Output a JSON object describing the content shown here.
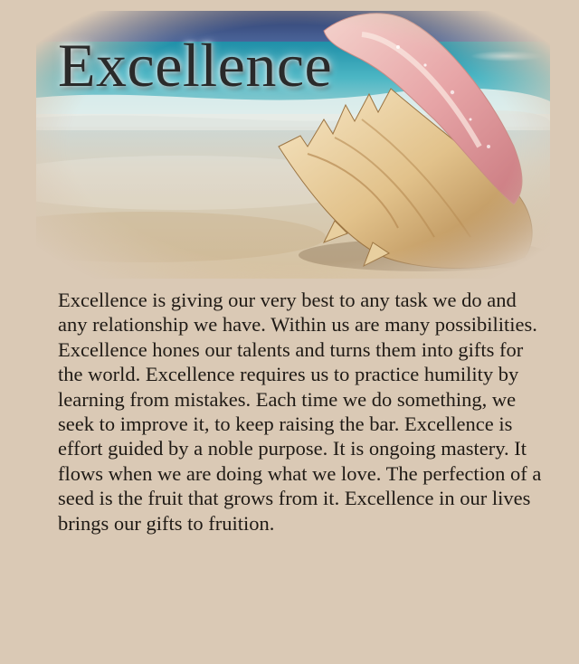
{
  "title": "Excellence",
  "body": "Excellence is giving our very best to any task we do and any relationship we have. Within us are many possibilities. Excellence hones our talents and turns them into gifts for the world. Excellence requires us to practice humility by learning from mistakes. Each time we do something, we seek to improve it, to keep raising the bar. Excellence is effort guided by a noble purpose. It is ongoing mastery. It flows when we are doing what we love. The perfection of a seed is the fruit that grows from it. Excellence in our lives brings our gifts to fruition.",
  "colors": {
    "background": "#dac9b5",
    "sea": "#3aa8b8",
    "sand": "#d9c6a6",
    "shell_pink": "#e2a6a6",
    "text": "#1f1a15"
  }
}
